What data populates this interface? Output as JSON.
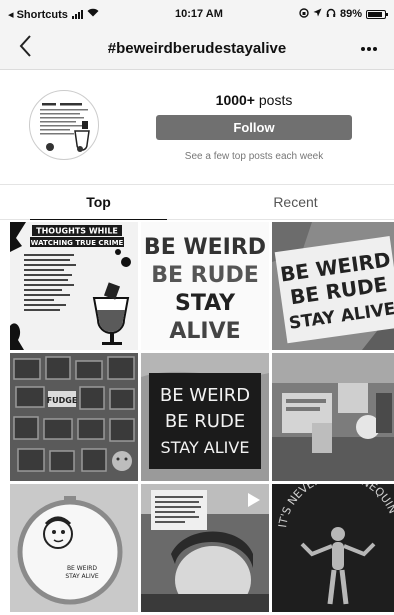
{
  "status_bar": {
    "back_app": "◂ Shortcuts",
    "time": "10:17 AM",
    "battery_percent": "89%",
    "battery_level": 0.89
  },
  "nav": {
    "title": "#beweirdberudestayalive"
  },
  "header": {
    "post_count": "1000+",
    "post_suffix": "posts",
    "follow_label": "Follow",
    "follow_subtitle": "See a few top posts each week"
  },
  "tabs": [
    {
      "label": "Top"
    },
    {
      "label": "Recent"
    }
  ],
  "grid": {
    "post1": {
      "heading1": "THOUGHTS WHILE",
      "heading2": "WATCHING TRUE CRIME"
    },
    "post2": {
      "line1": "BE WEIRD",
      "line2": "BE RUDE",
      "line3": "STAY",
      "line4": "ALIVE"
    },
    "post3": {
      "line1": "BE WEIRD",
      "line2": "BE RUDE",
      "line3": "STAY ALIVE"
    },
    "post4": {
      "word": "FUDGE"
    },
    "post5": {
      "line1": "BE WEIRD",
      "line2": "BE RUDE",
      "line3": "STAY ALIVE"
    },
    "post6": {},
    "post7": {
      "line1": "BE WEIRD",
      "line2": "STAY ALIVE"
    },
    "post8": {
      "is_video": true
    },
    "post9": {
      "caption": "IT'S NEVER A MANNEQUIN"
    }
  },
  "colors": {
    "button_bg": "#707070",
    "bar_bg": "#f4f4f4",
    "text": "#111111",
    "subtext": "#777777"
  }
}
